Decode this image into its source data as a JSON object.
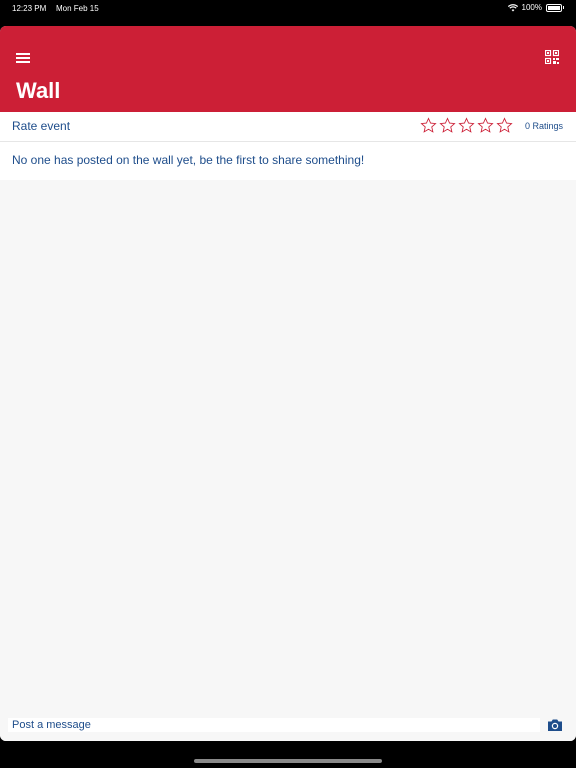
{
  "status_bar": {
    "time": "12:23 PM",
    "date": "Mon Feb 15",
    "battery": "100%"
  },
  "header": {
    "title": "Wall",
    "color": "#cc1f36",
    "menu_icon": "menu-icon",
    "qr_icon": "qr-code-icon"
  },
  "rating": {
    "label": "Rate event",
    "stars_total": 5,
    "stars_filled": 0,
    "count_label": "0 Ratings",
    "star_color": "#cc1f36"
  },
  "wall": {
    "empty_message": "No one has posted on the wall yet, be the first to share something!"
  },
  "composer": {
    "placeholder": "Post a message",
    "camera_icon": "camera-icon"
  },
  "colors": {
    "text_accent": "#1e4d8b"
  }
}
